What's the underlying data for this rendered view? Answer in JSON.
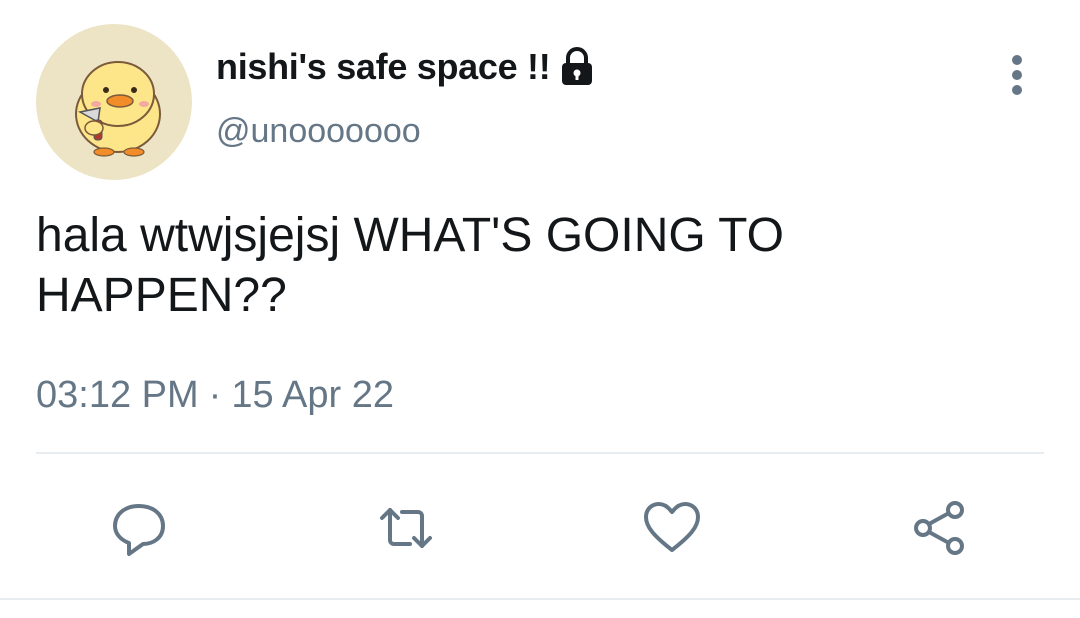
{
  "tweet": {
    "author": {
      "display_name": "nishi's safe space !!",
      "handle": "@unooooooo",
      "avatar_icon": "duck-with-knife-avatar",
      "protected_icon": "lock-icon"
    },
    "text": "hala wtwjsjejsj WHAT'S GOING TO HAPPEN??",
    "time": "03:12 PM",
    "separator": "·",
    "date": "15 Apr 22",
    "menu_icon": "more-vertical-icon",
    "actions": [
      {
        "name": "reply",
        "icon": "reply-icon"
      },
      {
        "name": "retweet",
        "icon": "retweet-icon"
      },
      {
        "name": "like",
        "icon": "heart-icon"
      },
      {
        "name": "share",
        "icon": "share-icon"
      }
    ]
  },
  "colors": {
    "text_primary": "#14171a",
    "text_secondary": "#657786",
    "divider": "#e6ecf0",
    "avatar_bg": "#ece4c5",
    "duck_yellow": "#fde68a"
  }
}
